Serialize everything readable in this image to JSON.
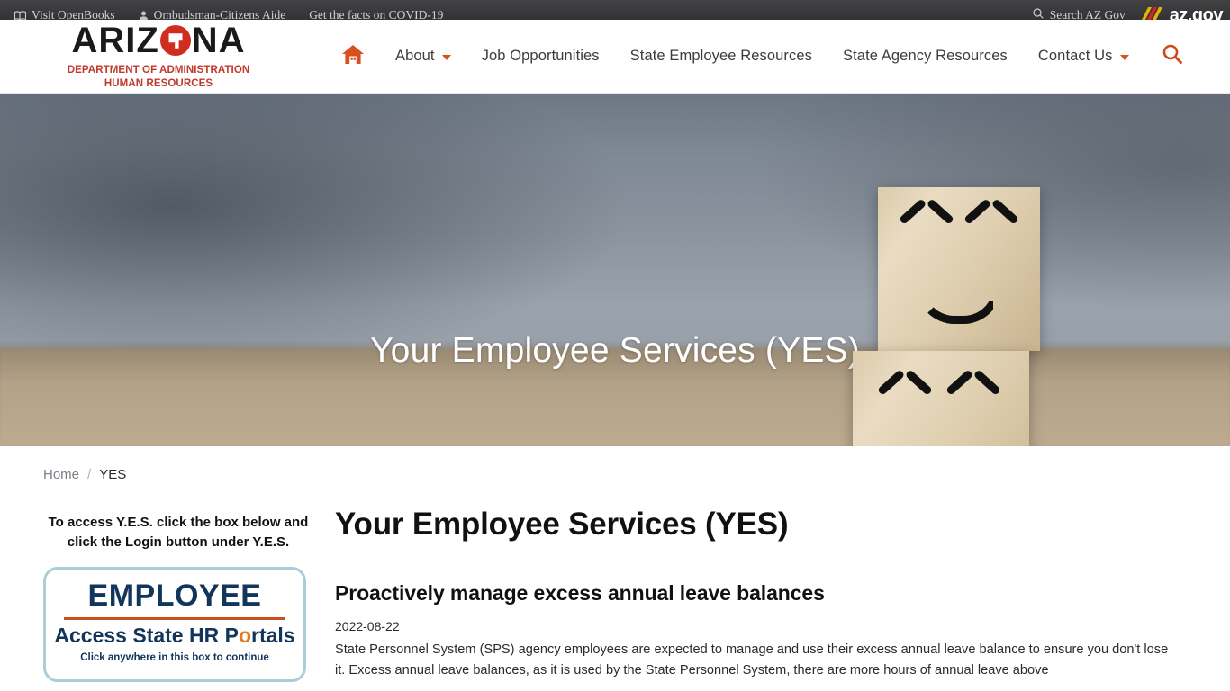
{
  "topbar": {
    "links": [
      {
        "icon": "openbooks-icon",
        "label": "Visit OpenBooks"
      },
      {
        "icon": "ombudsman-icon",
        "label": "Ombudsman-Citizens Aide"
      },
      {
        "icon": "none",
        "label": "Get the facts on COVID-19"
      }
    ],
    "search_label": "Search AZ Gov",
    "azgov_label": "az.gov"
  },
  "header": {
    "logo": {
      "part1": "ARIZ",
      "part2": "NA",
      "sub1": "DEPARTMENT OF ADMINISTRATION",
      "sub2": "HUMAN RESOURCES"
    },
    "nav": [
      {
        "label": "",
        "icon": "home-icon",
        "caret": false
      },
      {
        "label": "About",
        "icon": "",
        "caret": true
      },
      {
        "label": "Job Opportunities",
        "icon": "",
        "caret": false
      },
      {
        "label": "State Employee Resources",
        "icon": "",
        "caret": false
      },
      {
        "label": "State Agency Resources",
        "icon": "",
        "caret": false
      },
      {
        "label": "Contact Us",
        "icon": "",
        "caret": true
      }
    ],
    "search_icon": "search-icon"
  },
  "hero": {
    "title": "Your Employee Services (YES)"
  },
  "breadcrumb": {
    "home": "Home",
    "separator": "/",
    "current": "YES"
  },
  "sidebar": {
    "note": "To access Y.E.S. click the box below and click the Login button under Y.E.S.",
    "portal": {
      "title": "EMPLOYEE",
      "subtitle_pre": "Access State HR P",
      "subtitle_accent": "o",
      "subtitle_post": "rtals",
      "hint": "Click anywhere in this box to continue"
    }
  },
  "main": {
    "page_title": "Your Employee Services (YES)",
    "post": {
      "heading": "Proactively manage excess annual leave balances",
      "date": "2022-08-22",
      "body": "State Personnel System (SPS) agency employees are expected to manage and use their excess annual leave balance to ensure you don't lose it. Excess annual leave balances, as it is used by the State Personnel System, there are more hours of annual leave above"
    }
  },
  "colors": {
    "accent_orange": "#d9501e",
    "logo_red": "#cf2e1f",
    "portal_navy": "#12355b",
    "portal_border": "#a9cdd9",
    "portal_rule": "#c8501d",
    "topbar_bg": "#3b3b3d"
  }
}
